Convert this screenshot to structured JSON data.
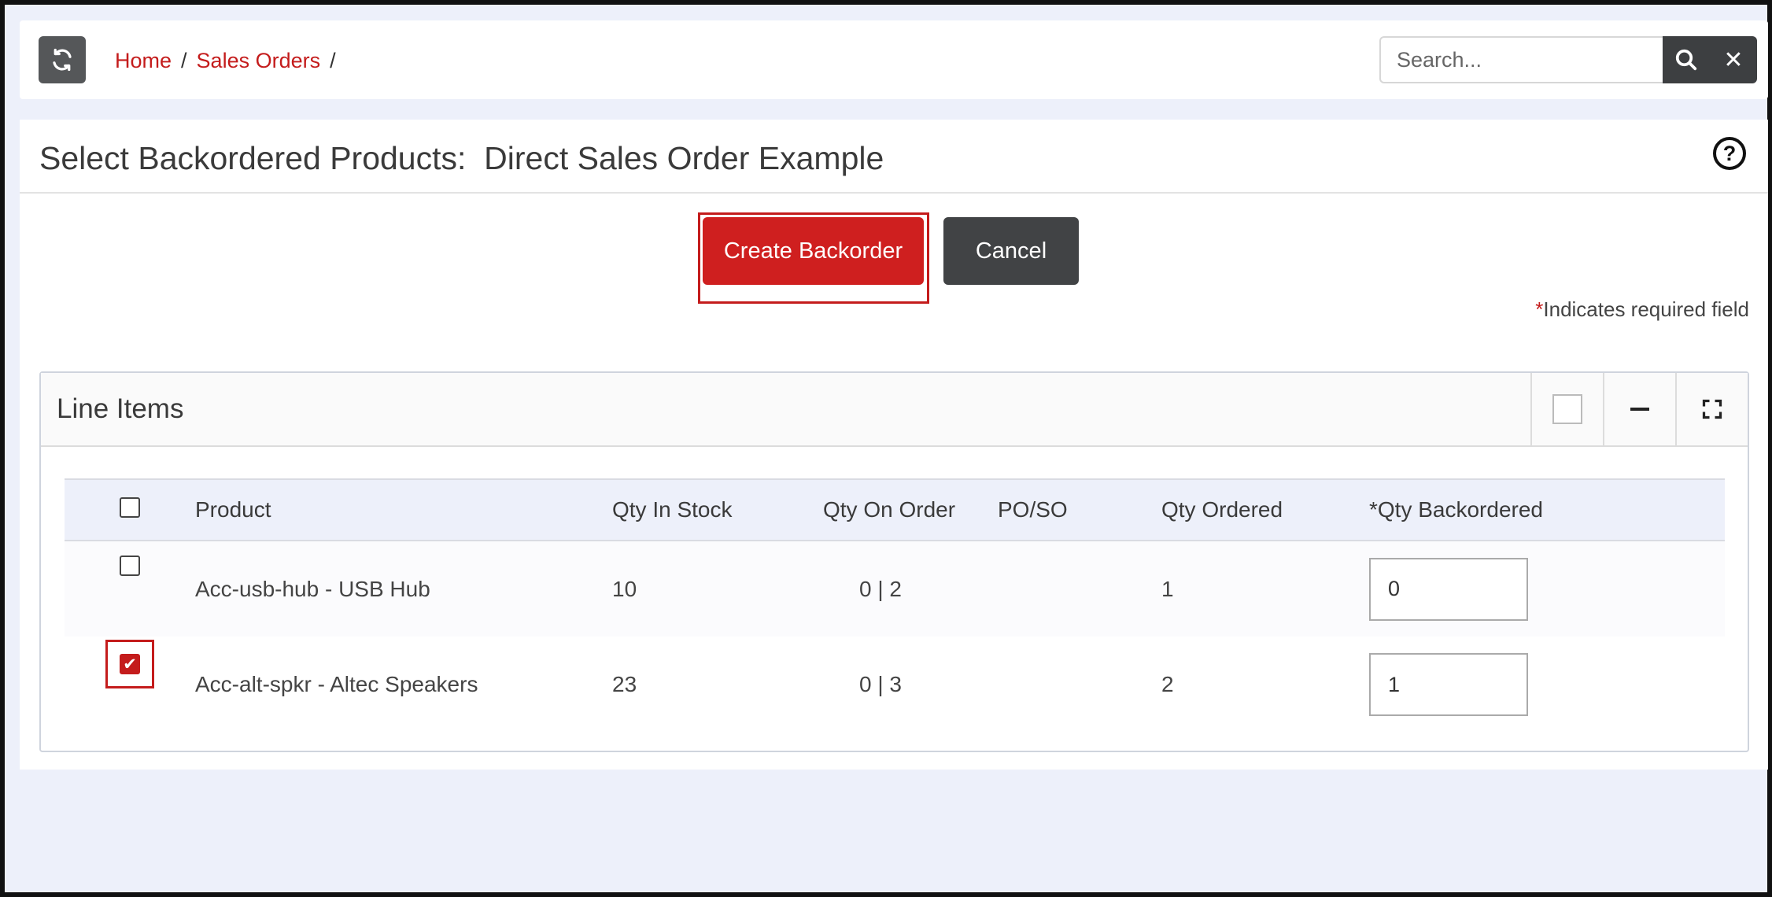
{
  "breadcrumb": {
    "home": "Home",
    "sales_orders": "Sales Orders",
    "separator": "/"
  },
  "search": {
    "placeholder": "Search...",
    "clear_label": "✕"
  },
  "page": {
    "title": "Select Backordered Products:  Direct Sales Order Example",
    "help_label": "?"
  },
  "actions": {
    "create_label": "Create Backorder",
    "cancel_label": "Cancel"
  },
  "required_note": {
    "star": "*",
    "text": "Indicates required field"
  },
  "panel": {
    "title": "Line Items"
  },
  "table": {
    "headers": [
      "Product",
      "Qty In Stock",
      "Qty On Order",
      "PO/SO",
      "Qty Ordered",
      "*Qty Backordered"
    ],
    "rows": [
      {
        "checked": false,
        "product": "Acc-usb-hub - USB Hub",
        "qty_in_stock": "10",
        "qty_on_order": "0 | 2",
        "po_so": "",
        "qty_ordered": "1",
        "qty_backordered": "0"
      },
      {
        "checked": true,
        "product": "Acc-alt-spkr - Altec Speakers",
        "qty_in_stock": "23",
        "qty_on_order": "0 | 3",
        "po_so": "",
        "qty_ordered": "2",
        "qty_backordered": "1"
      }
    ]
  },
  "colors": {
    "accent": "#c41c1c",
    "dark_button": "#414345",
    "page_bg": "#edf0fa"
  }
}
